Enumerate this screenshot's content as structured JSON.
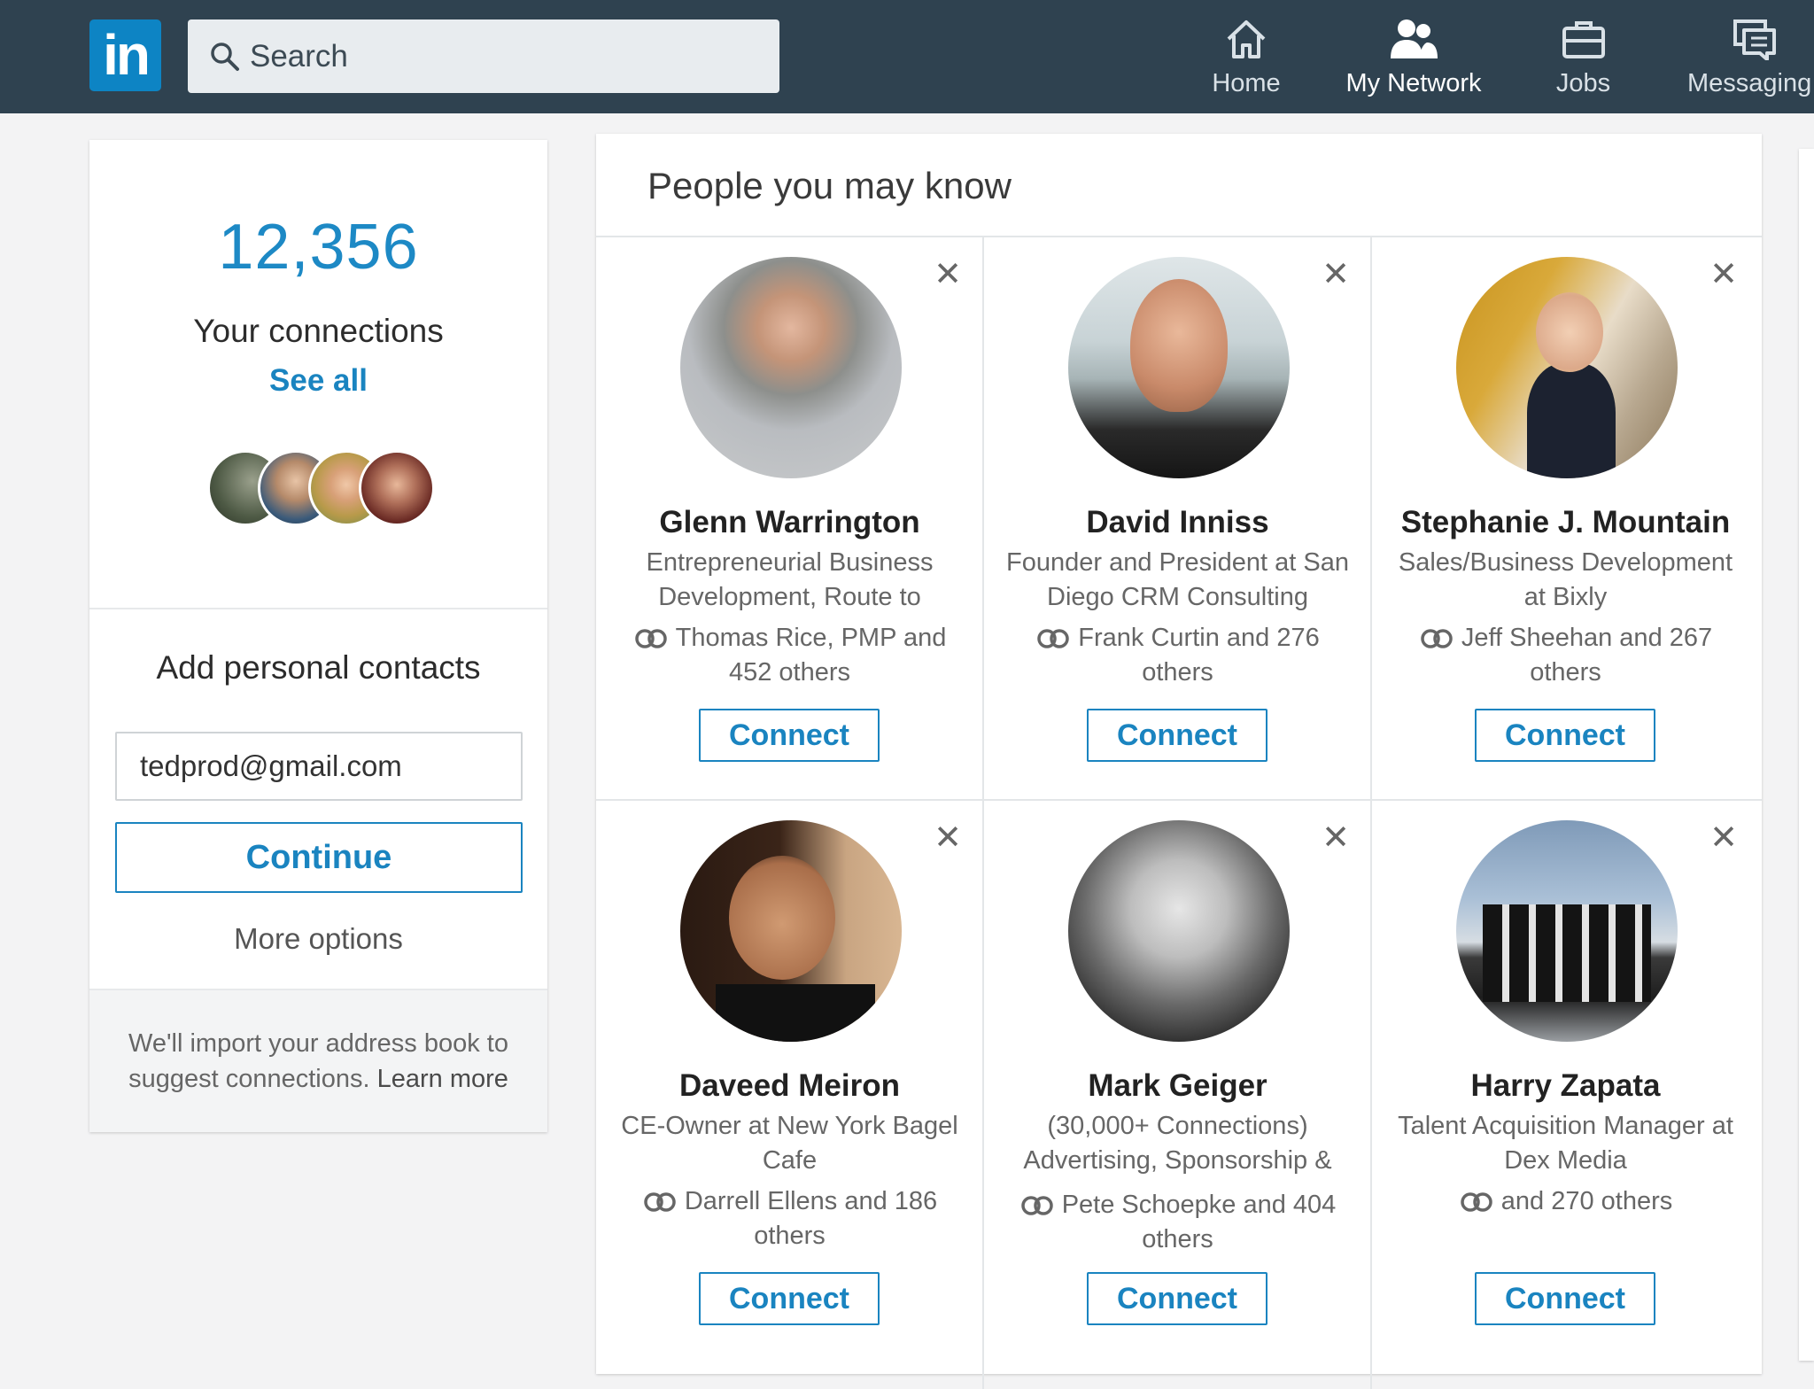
{
  "header": {
    "logo": "in",
    "search_placeholder": "Search",
    "nav": [
      {
        "label": "Home",
        "icon": "home-icon"
      },
      {
        "label": "My Network",
        "icon": "network-icon"
      },
      {
        "label": "Jobs",
        "icon": "briefcase-icon"
      },
      {
        "label": "Messaging",
        "icon": "messaging-icon"
      }
    ]
  },
  "sidebar": {
    "connections_count": "12,356",
    "connections_label": "Your connections",
    "see_all": "See all",
    "add_contacts_title": "Add personal contacts",
    "email_value": "tedprod@gmail.com",
    "continue_label": "Continue",
    "more_options": "More options",
    "import_text": "We'll import your address book to suggest connections.",
    "learn_more": "Learn more"
  },
  "pymk": {
    "title": "People you may know",
    "people": [
      {
        "name": "Glenn Warrington",
        "headline": "Entrepreneurial Business Development, Route to",
        "mutual": "Thomas Rice, PMP and 452 others",
        "action": "Connect"
      },
      {
        "name": "David Inniss",
        "headline": "Founder and President at San Diego CRM Consulting",
        "mutual": "Frank Curtin and 276 others",
        "action": "Connect"
      },
      {
        "name": "Stephanie J. Mountain",
        "headline": "Sales/Business Development at Bixly",
        "mutual": "Jeff Sheehan and 267 others",
        "action": "Connect"
      },
      {
        "name": "Daveed Meiron",
        "headline": "CE-Owner at New York Bagel Cafe",
        "mutual": "Darrell Ellens and 186 others",
        "action": "Connect"
      },
      {
        "name": "Mark Geiger",
        "headline": "(30,000+ Connections) Advertising, Sponsorship &",
        "mutual": "Pete Schoepke and 404 others",
        "action": "Connect"
      },
      {
        "name": "Harry Zapata",
        "headline": "Talent Acquisition Manager at Dex Media",
        "mutual": "and 270 others",
        "action": "Connect"
      }
    ]
  },
  "colors": {
    "topbar": "#2f4250",
    "brand_blue": "#0d84c4",
    "link_blue": "#1a84c0",
    "page_bg": "#f3f3f4"
  }
}
